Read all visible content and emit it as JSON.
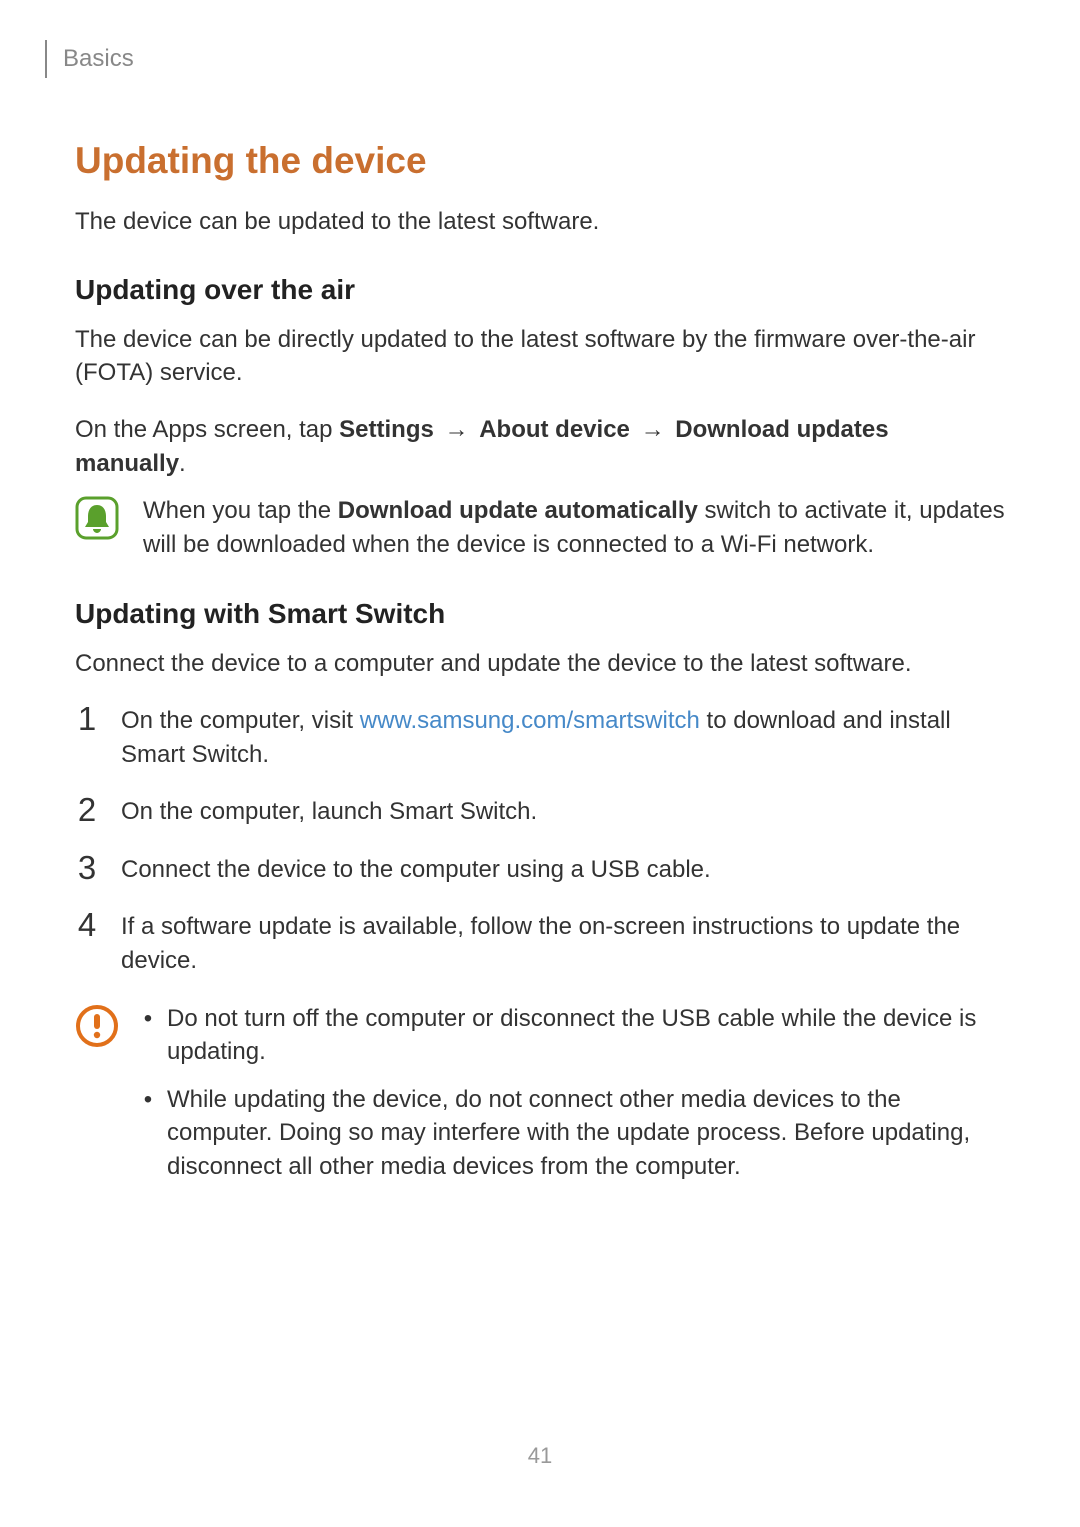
{
  "header": "Basics",
  "title": "Updating the device",
  "intro": "The device can be updated to the latest software.",
  "ota": {
    "heading": "Updating over the air",
    "para1": "The device can be directly updated to the latest software by the firmware over-the-air (FOTA) service.",
    "path_prefix": "On the Apps screen, tap",
    "path_seg1": "Settings",
    "path_seg2": "About device",
    "path_seg3": "Download updates manually",
    "arrow": "→",
    "note_pre": "When you tap the",
    "note_bold": "Download update automatically",
    "note_post": "switch to activate it, updates will be downloaded when the device is connected to a Wi-Fi network."
  },
  "ss": {
    "heading": "Updating with Smart Switch",
    "intro": "Connect the device to a computer and update the device to the latest software.",
    "steps": {
      "s1_pre": "On the computer, visit",
      "s1_link": "www.samsung.com/smartswitch",
      "s1_post": "to download and install Smart Switch.",
      "s2": "On the computer, launch Smart Switch.",
      "s3": "Connect the device to the computer using a USB cable.",
      "s4": "If a software update is available, follow the on-screen instructions to update the device."
    },
    "warn1": "Do not turn off the computer or disconnect the USB cable while the device is updating.",
    "warn2": "While updating the device, do not connect other media devices to the computer. Doing so may interfere with the update process. Before updating, disconnect all other media devices from the computer."
  },
  "nums": {
    "n1": "1",
    "n2": "2",
    "n3": "3",
    "n4": "4"
  },
  "bullet": "•",
  "page_number": "41"
}
